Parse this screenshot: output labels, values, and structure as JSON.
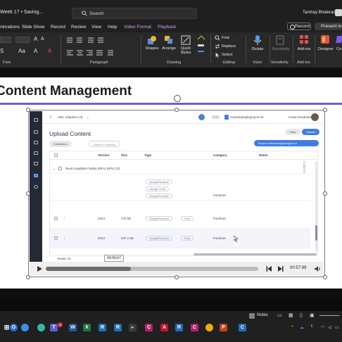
{
  "titlebar": {
    "doc_title": "Week 17 • Saving...",
    "search_placeholder": "Search",
    "user_name": "Tanmay Bhalerao"
  },
  "ribbon": {
    "tabs": [
      "nimations",
      "Slide Show",
      "Record",
      "Review",
      "View",
      "Help",
      "Video Format",
      "Playback"
    ],
    "record_label": "Record",
    "present_label": "Present in",
    "buttons": {
      "shapes": "Shapes",
      "arrange": "Arrange",
      "quick_styles": "Quick Styles",
      "find": "Find",
      "replace": "Replace",
      "select": "Select",
      "dictate": "Dictate",
      "sensitivity": "Sensitivity",
      "addins": "Add-ins",
      "designer": "Designer",
      "copilot": "Co"
    },
    "groups": [
      "Font",
      "Paragraph",
      "Drawing",
      "Editing",
      "Voice",
      "Sensitivity",
      "Add-ins"
    ]
  },
  "slide": {
    "title": "Content Management"
  },
  "video": {
    "app_name": "AEC Adoption US",
    "project": "rvctestsampleproject.rvt",
    "user": "Cesar Escalante",
    "page_heading": "Upload Content",
    "collections_btn": "Collections",
    "default_collection": "Default Collection",
    "clear_btn": "Clear",
    "upload_btn": "Upload",
    "export_btn": "Export rvctestsampleproject.rvt",
    "columns": [
      "Version",
      "Size",
      "Tags",
      "Category",
      "Notes"
    ],
    "group_row": "Revit Loadable Family (RFA) (RFA) (2)",
    "side_tab": "Columns",
    "rows": [
      {
        "version": "",
        "size": "",
        "tags": [
          "SampleFurniture",
          "Lounge Chair",
          "SampleFurniture"
        ],
        "category": "Furniture"
      },
      {
        "version": "2024",
        "size": "475 kB",
        "tags": [
          "SampleFurniture",
          "Sofa"
        ],
        "category": "Furniture"
      },
      {
        "version": "2024",
        "size": "537.1 kB",
        "tags": [
          "SampleFurniture",
          "Sofa"
        ],
        "category": "Furniture"
      }
    ],
    "rows_footer": "Rows: 21",
    "tooltip_time": "00:56:67",
    "duration": "00:57:99",
    "progress_fraction": 0.4
  },
  "taskbar": {
    "notes_label": "Notes",
    "apps": [
      "O",
      "W",
      "X",
      "R",
      "R",
      "C",
      "A",
      "R",
      "C",
      "P",
      "C"
    ]
  }
}
